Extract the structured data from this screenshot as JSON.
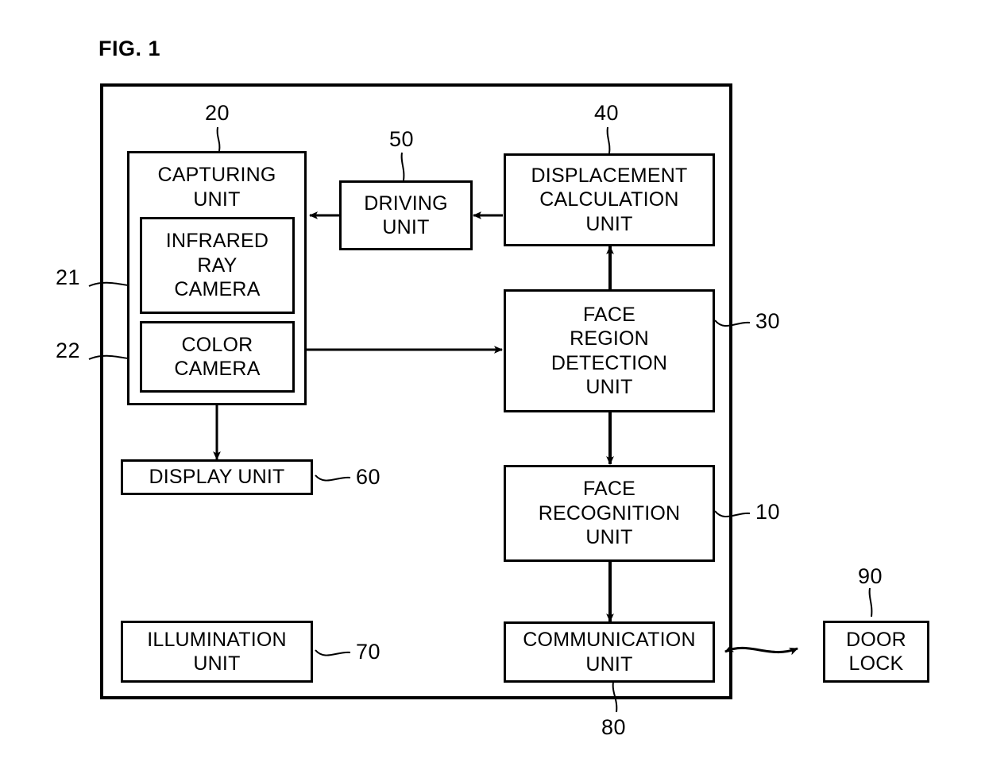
{
  "figure": {
    "title": "FIG. 1"
  },
  "boxes": {
    "capturing_unit": {
      "label": "CAPTURING\nUNIT",
      "ref": "20"
    },
    "infrared_ray_camera": {
      "label": "INFRARED\nRAY\nCAMERA",
      "ref": "21"
    },
    "color_camera": {
      "label": "COLOR\nCAMERA",
      "ref": "22"
    },
    "driving_unit": {
      "label": "DRIVING\nUNIT",
      "ref": "50"
    },
    "displacement_calculation_unit": {
      "label": "DISPLACEMENT\nCALCULATION\nUNIT",
      "ref": "40"
    },
    "face_region_detection_unit": {
      "label": "FACE\nREGION\nDETECTION\nUNIT",
      "ref": "30"
    },
    "face_recognition_unit": {
      "label": "FACE\nRECOGNITION\nUNIT",
      "ref": "10"
    },
    "communication_unit": {
      "label": "COMMUNICATION\nUNIT",
      "ref": "80"
    },
    "display_unit": {
      "label": "DISPLAY UNIT",
      "ref": "60"
    },
    "illumination_unit": {
      "label": "ILLUMINATION\nUNIT",
      "ref": "70"
    },
    "door_lock": {
      "label": "DOOR\nLOCK",
      "ref": "90"
    }
  },
  "colors": {
    "stroke": "#000000",
    "background": "#ffffff"
  }
}
